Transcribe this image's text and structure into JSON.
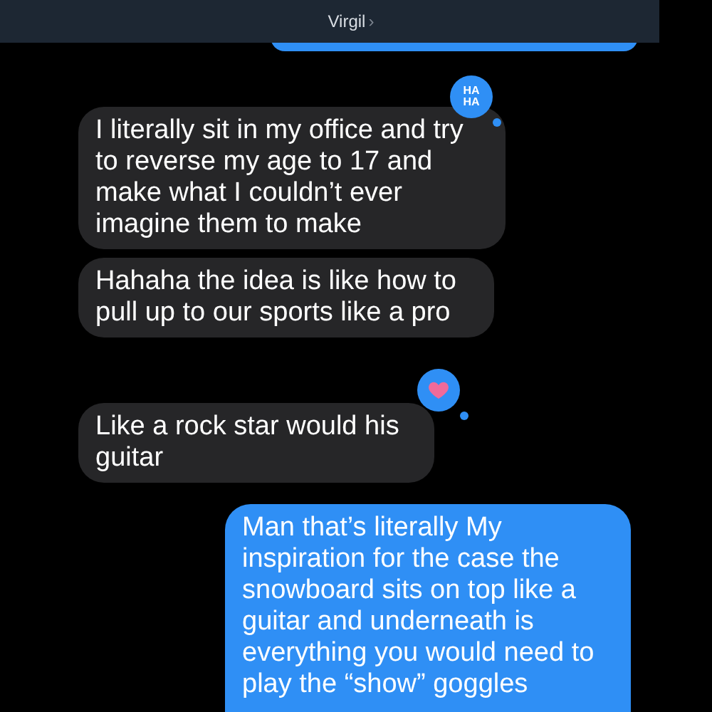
{
  "header": {
    "contact": "Virgil",
    "chevron": "›"
  },
  "messages": [
    {
      "kind": "incoming",
      "text": "I literally sit in my office and try to reverse my age to 17 and make what I couldn’t ever imagine them to make",
      "reaction": {
        "kind": "haha",
        "label": "HA HA"
      }
    },
    {
      "kind": "incoming",
      "text": "Hahaha the idea is like how to pull up to our sports like a pro"
    },
    {
      "kind": "incoming",
      "text": "Like a rock star would his guitar",
      "reaction": {
        "kind": "heart"
      }
    },
    {
      "kind": "outgoing",
      "text": "Man that’s literally My inspiration for the case the snowboard sits on top like a guitar and underneath is everything you would need to play the “show” goggles"
    }
  ]
}
